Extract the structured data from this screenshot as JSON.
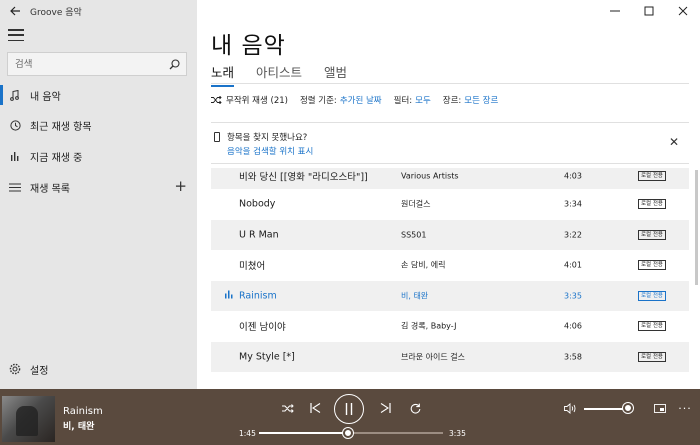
{
  "app": {
    "title": "Groove 음악"
  },
  "search": {
    "placeholder": "검색"
  },
  "sidebar": {
    "items": [
      {
        "label": "내 음악",
        "icon": "music-note-icon",
        "active": true
      },
      {
        "label": "최근 재생 항목",
        "icon": "clock-icon"
      },
      {
        "label": "지금 재생 중",
        "icon": "equalizer-icon"
      },
      {
        "label": "재생 목록",
        "icon": "playlist-icon"
      }
    ],
    "settings_label": "설정"
  },
  "main": {
    "title": "내 음악",
    "tabs": [
      {
        "label": "노래",
        "active": true
      },
      {
        "label": "아티스트"
      },
      {
        "label": "앨범"
      }
    ],
    "filters": {
      "shuffle_label": "무작위 재생 (21)",
      "sort_label": "정렬 기준:",
      "sort_value": "추가된 날짜",
      "filter_label": "필터:",
      "filter_value": "모두",
      "genre_label": "장르:",
      "genre_value": "모든 장르"
    },
    "notice": {
      "title": "항목을 찾지 못했나요?",
      "link": "음악을 검색할 위치 표시"
    },
    "songs": [
      {
        "title": "비와 당신 [[영화 \"라디오스타\"]]",
        "artist": "Various Artists",
        "duration": "4:03",
        "badge": "로컬 전용"
      },
      {
        "title": "Nobody",
        "artist": "원더걸스",
        "duration": "3:34",
        "badge": "로컬 전용"
      },
      {
        "title": "U R Man",
        "artist": "SS501",
        "duration": "3:22",
        "badge": "로컬 전용"
      },
      {
        "title": "미쳤어",
        "artist": "손 담비, 에릭",
        "duration": "4:01",
        "badge": "로컬 전용"
      },
      {
        "title": "Rainism",
        "artist": "비, 태완",
        "duration": "3:35",
        "badge": "로컬 전용",
        "playing": true
      },
      {
        "title": "이젠 남이야",
        "artist": "김 경록, Baby-J",
        "duration": "4:06",
        "badge": "로컬 전용"
      },
      {
        "title": "My Style [*]",
        "artist": "브라운 아이드 걸스",
        "duration": "3:58",
        "badge": "로컬 전용"
      }
    ]
  },
  "player": {
    "title": "Rainism",
    "artist": "비, 태완",
    "elapsed": "1:45",
    "total": "3:35",
    "progress": 0.488,
    "volume": 0.8
  },
  "colors": {
    "accent": "#1a73c9",
    "player_bg": "#5a4a3e",
    "sidebar_bg": "#e6e6e6"
  }
}
